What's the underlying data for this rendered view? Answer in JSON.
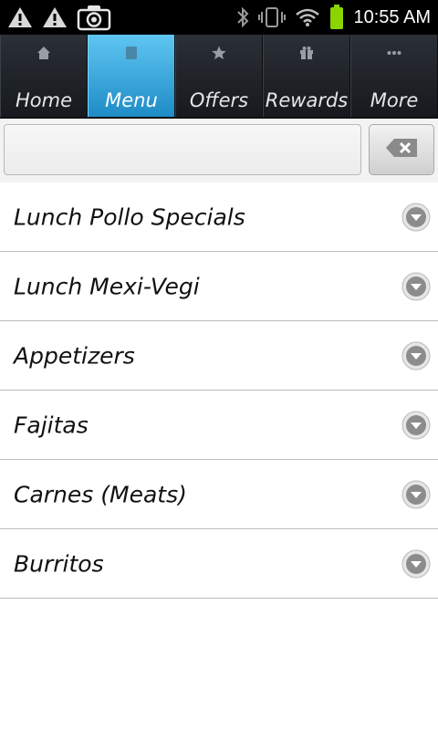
{
  "status_bar": {
    "time": "10:55 AM",
    "icons": [
      "warning-icon",
      "warning-icon",
      "camera-icon",
      "bluetooth-icon",
      "vibrate-icon",
      "wifi-icon",
      "battery-icon"
    ]
  },
  "tabs": [
    {
      "label": "Home",
      "icon": "home-icon",
      "active": false
    },
    {
      "label": "Menu",
      "icon": "menu-icon",
      "active": true
    },
    {
      "label": "Offers",
      "icon": "star-icon",
      "active": false
    },
    {
      "label": "Rewards",
      "icon": "gift-icon",
      "active": false
    },
    {
      "label": "More",
      "icon": "more-icon",
      "active": false
    }
  ],
  "search": {
    "value": "",
    "placeholder": "",
    "clear_icon": "backspace-icon"
  },
  "menu_items": [
    {
      "label": "Lunch Pollo Specials"
    },
    {
      "label": "Lunch Mexi-Vegi"
    },
    {
      "label": "Appetizers"
    },
    {
      "label": "Fajitas"
    },
    {
      "label": "Carnes (Meats)"
    },
    {
      "label": "Burritos"
    }
  ],
  "colors": {
    "active_tab": "#2aa3dc",
    "tab_bar": "#1d2126",
    "battery": "#8bd400"
  }
}
